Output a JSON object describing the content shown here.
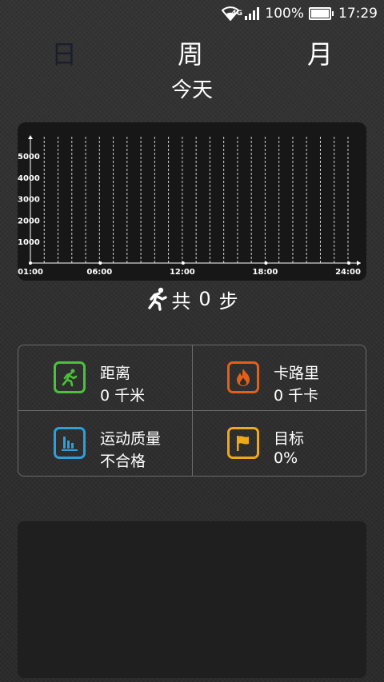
{
  "statusbar": {
    "network": "4G",
    "battery": "100%",
    "time": "17:29"
  },
  "tabs": [
    {
      "label": "日",
      "color": "#1b1e2b"
    },
    {
      "label": "周",
      "color": "#ffffff"
    },
    {
      "label": "月",
      "color": "#ffffff"
    }
  ],
  "date_label": "今天",
  "chart_data": {
    "type": "bar",
    "x_ticks": [
      "01:00",
      "06:00",
      "12:00",
      "18:00",
      "24:00"
    ],
    "y_ticks": [
      1000,
      2000,
      3000,
      4000,
      5000
    ],
    "ylim": [
      0,
      5000
    ],
    "values": [],
    "grid": "vertical dashed",
    "title": "",
    "xlabel": "",
    "ylabel": ""
  },
  "steps": {
    "prefix": "共",
    "count": "0",
    "unit": "步"
  },
  "stats": [
    {
      "label": "距离",
      "value": "0 千米",
      "icon": "running-man-icon",
      "color": "#4cc13c"
    },
    {
      "label": "卡路里",
      "value": "0 千卡",
      "icon": "flame-icon",
      "color": "#e2601a"
    },
    {
      "label": "运动质量",
      "value": "不合格",
      "icon": "bar-chart-icon",
      "color": "#2e9fd8"
    },
    {
      "label": "目标",
      "value": "0%",
      "icon": "flag-icon",
      "color": "#f0a818"
    }
  ]
}
